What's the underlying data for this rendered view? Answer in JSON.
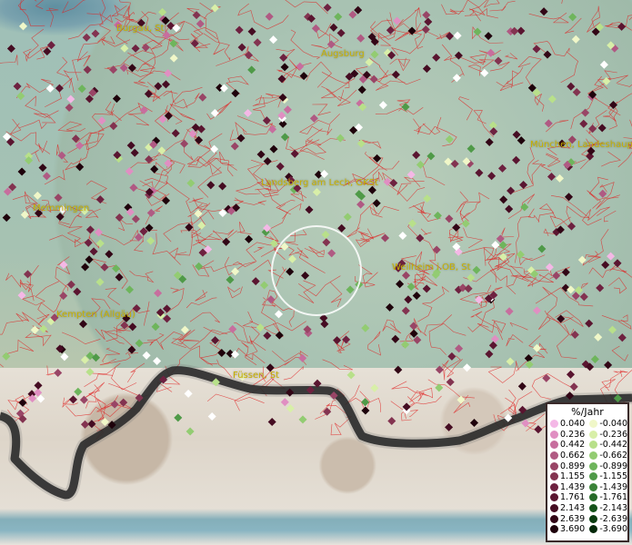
{
  "places": [
    {
      "name": "Burgau, St"
    },
    {
      "name": "Augsburg"
    },
    {
      "name": "München, Landeshaup"
    },
    {
      "name": "Landsberg am Lech, GKSt"
    },
    {
      "name": "Memmingen"
    },
    {
      "name": "Weilheim i.OB, St"
    },
    {
      "name": "Kempten (Allgäu)"
    },
    {
      "name": "Füssen, St"
    }
  ],
  "legend": {
    "title": "%/Jahr",
    "positive": [
      {
        "label": "0.040",
        "color": "#f4b8e6"
      },
      {
        "label": "0.236",
        "color": "#e08fc2"
      },
      {
        "label": "0.442",
        "color": "#c76e9e"
      },
      {
        "label": "0.662",
        "color": "#b05a83"
      },
      {
        "label": "0.899",
        "color": "#994566"
      },
      {
        "label": "1.155",
        "color": "#833350"
      },
      {
        "label": "1.439",
        "color": "#6e2140"
      },
      {
        "label": "1.761",
        "color": "#5a1530"
      },
      {
        "label": "2.143",
        "color": "#450c22"
      },
      {
        "label": "2.639",
        "color": "#320616"
      },
      {
        "label": "3.690",
        "color": "#1e020b"
      }
    ],
    "negative": [
      {
        "label": "-0.040",
        "color": "#f0f7c8"
      },
      {
        "label": "-0.236",
        "color": "#d8efa8"
      },
      {
        "label": "-0.442",
        "color": "#b8e08a"
      },
      {
        "label": "-0.662",
        "color": "#93cc72"
      },
      {
        "label": "-0.899",
        "color": "#6eb55c"
      },
      {
        "label": "-1.155",
        "color": "#4f9a48"
      },
      {
        "label": "-1.439",
        "color": "#3a8338"
      },
      {
        "label": "-1.761",
        "color": "#266a28"
      },
      {
        "label": "-2.143",
        "color": "#15531a"
      },
      {
        "label": "-2.639",
        "color": "#0a3d10"
      },
      {
        "label": "-3.690",
        "color": "#032808"
      }
    ]
  },
  "colors": {
    "boundary": "#e02020",
    "label": "#c8b000",
    "border": "#101010",
    "highlight": "#ffffff"
  }
}
